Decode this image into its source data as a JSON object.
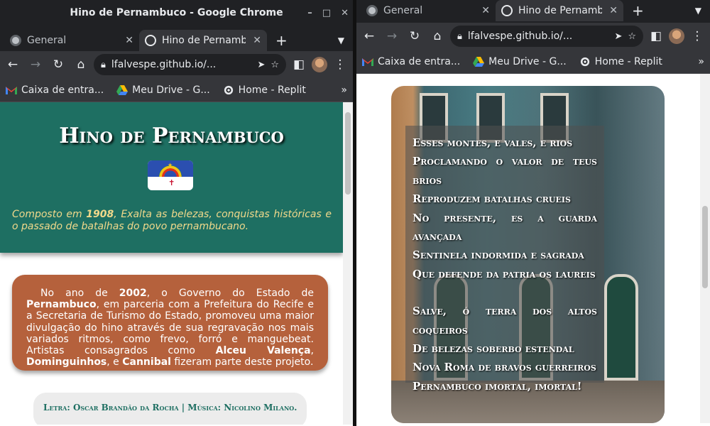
{
  "left_window": {
    "title": "Hino de Pernambuco - Google Chrome",
    "controls": {
      "minimize": "–",
      "maximize": "□",
      "close": "✕"
    },
    "tabs": [
      {
        "label": "General",
        "icon": "github-icon"
      },
      {
        "label": "Hino de Pernamb",
        "icon": "globe-icon",
        "active": true
      }
    ],
    "url": "lfalvespe.github.io/...",
    "bookmarks": [
      {
        "label": "Caixa de entra...",
        "icon": "gmail-icon"
      },
      {
        "label": "Meu Drive - G...",
        "icon": "drive-icon"
      },
      {
        "label": "Home - Replit",
        "icon": "replit-icon"
      }
    ],
    "page": {
      "title": "Hino de Pernambuco",
      "intro_pre": "Composto em ",
      "intro_year": "1908",
      "intro_post": ", Exalta as belezas, conquistas históricas e o passado de batalhas do povo pernambucano.",
      "history": {
        "t1": "No ano de ",
        "b1": "2002",
        "t2": ", o Governo do Estado de ",
        "b2": "Pernambuco",
        "t3": ", em parceria com a Prefeitura do Recife e a Secretaria de Turismo do Estado, promoveu uma maior divulgação do hino através de sua regravação nos mais variados ritmos, como frevo, forró e manguebeat. Artistas consagrados como ",
        "b3": "Alceu Valença",
        "t4": ", ",
        "b4": "Dominguinhos",
        "t5": ", e ",
        "b5": "Cannibal",
        "t6": " fizeram parte deste projeto."
      },
      "credits": "Letra: Oscar Brandão da Rocha | Música: Nicolino Milano."
    }
  },
  "right_window": {
    "tabs": [
      {
        "label": "General",
        "icon": "github-icon"
      },
      {
        "label": "Hino de Pernamb",
        "icon": "globe-icon",
        "active": true
      }
    ],
    "url": "lfalvespe.github.io/...",
    "bookmarks": [
      {
        "label": "Caixa de entra...",
        "icon": "gmail-icon"
      },
      {
        "label": "Meu Drive - G...",
        "icon": "drive-icon"
      },
      {
        "label": "Home - Replit",
        "icon": "replit-icon"
      }
    ],
    "lyrics": {
      "verse1": [
        "Esses montes, e vales, e rios",
        "Proclamando o valor de teus brios",
        "Reproduzem batalhas crueis",
        "No presente, es a guarda avançada",
        "Sentinela indormida e sagrada",
        "Que defende da patria os laureis"
      ],
      "verse2": [
        "Salve, ó terra dos altos coqueiros",
        "De belezas soberbo estendal",
        "Nova Roma de bravos guerreiros",
        "Pernambuco imortal, imortal!"
      ]
    }
  },
  "colors": {
    "header_green": "#1e6f62",
    "intro_yellow": "#f1d98b",
    "history_orange": "#b5613c",
    "chrome_dark": "#202124",
    "chrome_toolbar": "#35363a"
  }
}
